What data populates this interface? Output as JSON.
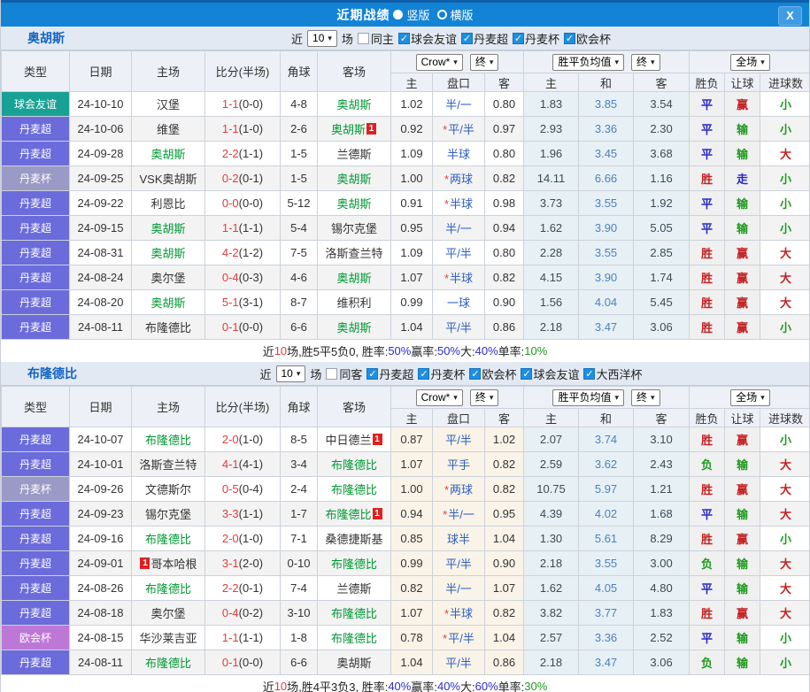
{
  "titlebar": {
    "title": "近期战绩",
    "radios": [
      {
        "label": "竖版",
        "selected": true
      },
      {
        "label": "横版",
        "selected": false
      }
    ],
    "close_label": "X"
  },
  "filter_labels": {
    "near": "近",
    "games": "场"
  },
  "header_labels": {
    "type": "类型",
    "date": "日期",
    "home": "主场",
    "score": "比分(半场)",
    "corner": "角球",
    "away": "客场",
    "bookmaker": "Crow*",
    "final": "终",
    "mean_title": "胜平负均值",
    "fullmatch": "全场",
    "odds_home": "主",
    "odds_handicap": "盘口",
    "odds_away": "客",
    "mean_home": "主",
    "mean_draw": "和",
    "mean_away": "客",
    "result": "胜负",
    "handicap": "让球",
    "goals": "进球数"
  },
  "type_colors": {
    "球会友谊": "#18a295",
    "丹麦超": "#6b6bdb",
    "丹麦杯": "#9a9ac6",
    "欧会杯": "#bd77d6"
  },
  "colors": {
    "titlebar_blue": "#1383d6",
    "checkbox_blue": "#1e8fe0",
    "score_red": "#e43b3b",
    "team_green": "#009933",
    "rank_badge_red": "#e02020"
  },
  "sections": [
    {
      "team": "奥胡斯",
      "filter": {
        "count": "10",
        "same_label": "同主",
        "same_checked": false,
        "leagues": [
          "球会友谊",
          "丹麦超",
          "丹麦杯",
          "欧会杯"
        ]
      },
      "rows": [
        {
          "type": "球会友谊",
          "date": "24-10-10",
          "home": "汉堡",
          "home_green": false,
          "score": "1-1",
          "half": "(0-0)",
          "corners": "4-8",
          "away": "奥胡斯",
          "away_green": true,
          "odds": [
            "1.02",
            "半/一",
            "0.80"
          ],
          "star": false,
          "mean": [
            "1.83",
            "3.85",
            "3.54"
          ],
          "result": "平",
          "handicap_result": "赢",
          "goals": "小"
        },
        {
          "type": "丹麦超",
          "date": "24-10-06",
          "home": "维堡",
          "home_green": false,
          "score": "1-1",
          "half": "(1-0)",
          "corners": "2-6",
          "away": "奥胡斯",
          "away_green": true,
          "away_badge": "1",
          "odds": [
            "0.92",
            "平/半",
            "0.97"
          ],
          "star": true,
          "mean": [
            "2.93",
            "3.36",
            "2.30"
          ],
          "result": "平",
          "handicap_result": "输",
          "goals": "小"
        },
        {
          "type": "丹麦超",
          "date": "24-09-28",
          "home": "奥胡斯",
          "home_green": true,
          "score": "2-2",
          "half": "(1-1)",
          "corners": "1-5",
          "away": "兰德斯",
          "away_green": false,
          "odds": [
            "1.09",
            "半球",
            "0.80"
          ],
          "star": false,
          "mean": [
            "1.96",
            "3.45",
            "3.68"
          ],
          "result": "平",
          "handicap_result": "输",
          "goals": "大"
        },
        {
          "type": "丹麦杯",
          "date": "24-09-25",
          "home": "VSK奥胡斯",
          "home_green": false,
          "score": "0-2",
          "half": "(0-1)",
          "corners": "1-5",
          "away": "奥胡斯",
          "away_green": true,
          "odds": [
            "1.00",
            "两球",
            "0.82"
          ],
          "star": true,
          "mean": [
            "14.11",
            "6.66",
            "1.16"
          ],
          "result": "胜",
          "handicap_result": "走",
          "goals": "小"
        },
        {
          "type": "丹麦超",
          "date": "24-09-22",
          "home": "利恩比",
          "home_green": false,
          "score": "0-0",
          "half": "(0-0)",
          "corners": "5-12",
          "away": "奥胡斯",
          "away_green": true,
          "odds": [
            "0.91",
            "半球",
            "0.98"
          ],
          "star": true,
          "mean": [
            "3.73",
            "3.55",
            "1.92"
          ],
          "result": "平",
          "handicap_result": "输",
          "goals": "小"
        },
        {
          "type": "丹麦超",
          "date": "24-09-15",
          "home": "奥胡斯",
          "home_green": true,
          "score": "1-1",
          "half": "(1-1)",
          "corners": "5-4",
          "away": "锡尔克堡",
          "away_green": false,
          "odds": [
            "0.95",
            "半/一",
            "0.94"
          ],
          "star": false,
          "mean": [
            "1.62",
            "3.90",
            "5.05"
          ],
          "result": "平",
          "handicap_result": "输",
          "goals": "小"
        },
        {
          "type": "丹麦超",
          "date": "24-08-31",
          "home": "奥胡斯",
          "home_green": true,
          "score": "4-2",
          "half": "(1-2)",
          "corners": "7-5",
          "away": "洛斯查兰特",
          "away_green": false,
          "odds": [
            "1.09",
            "平/半",
            "0.80"
          ],
          "star": false,
          "mean": [
            "2.28",
            "3.55",
            "2.85"
          ],
          "result": "胜",
          "handicap_result": "赢",
          "goals": "大"
        },
        {
          "type": "丹麦超",
          "date": "24-08-24",
          "home": "奥尔堡",
          "home_green": false,
          "score": "0-4",
          "half": "(0-3)",
          "corners": "4-6",
          "away": "奥胡斯",
          "away_green": true,
          "odds": [
            "1.07",
            "半球",
            "0.82"
          ],
          "star": true,
          "mean": [
            "4.15",
            "3.90",
            "1.74"
          ],
          "result": "胜",
          "handicap_result": "赢",
          "goals": "大"
        },
        {
          "type": "丹麦超",
          "date": "24-08-20",
          "home": "奥胡斯",
          "home_green": true,
          "score": "5-1",
          "half": "(3-1)",
          "corners": "8-7",
          "away": "维积利",
          "away_green": false,
          "odds": [
            "0.99",
            "一球",
            "0.90"
          ],
          "star": false,
          "mean": [
            "1.56",
            "4.04",
            "5.45"
          ],
          "result": "胜",
          "handicap_result": "赢",
          "goals": "大"
        },
        {
          "type": "丹麦超",
          "date": "24-08-11",
          "home": "布隆德比",
          "home_green": false,
          "score": "0-1",
          "half": "(0-0)",
          "corners": "6-6",
          "away": "奥胡斯",
          "away_green": true,
          "odds": [
            "1.04",
            "平/半",
            "0.86"
          ],
          "star": false,
          "mean": [
            "2.18",
            "3.47",
            "3.06"
          ],
          "result": "胜",
          "handicap_result": "赢",
          "goals": "小"
        }
      ],
      "summary": [
        {
          "t": "近",
          "c": "k"
        },
        {
          "t": "10",
          "c": "r"
        },
        {
          "t": "场,胜5平5负0, 胜率:",
          "c": "k"
        },
        {
          "t": "50%",
          "c": "b"
        },
        {
          "t": " 赢率:",
          "c": "k"
        },
        {
          "t": "50%",
          "c": "b"
        },
        {
          "t": " 大:",
          "c": "k"
        },
        {
          "t": "40%",
          "c": "b"
        },
        {
          "t": " 单率:",
          "c": "k"
        },
        {
          "t": "10%",
          "c": "g"
        }
      ]
    },
    {
      "team": "布隆德比",
      "filter": {
        "count": "10",
        "same_label": "同客",
        "same_checked": false,
        "leagues": [
          "丹麦超",
          "丹麦杯",
          "欧会杯",
          "球会友谊",
          "大西洋杯"
        ]
      },
      "rows": [
        {
          "type": "丹麦超",
          "date": "24-10-07",
          "home": "布隆德比",
          "home_green": true,
          "score": "2-0",
          "half": "(1-0)",
          "corners": "8-5",
          "away": "中日德兰",
          "away_green": false,
          "away_badge": "1",
          "odds": [
            "0.87",
            "平/半",
            "1.02"
          ],
          "star": false,
          "mean": [
            "2.07",
            "3.74",
            "3.10"
          ],
          "result": "胜",
          "handicap_result": "赢",
          "goals": "小"
        },
        {
          "type": "丹麦超",
          "date": "24-10-01",
          "home": "洛斯查兰特",
          "home_green": false,
          "score": "4-1",
          "half": "(4-1)",
          "corners": "3-4",
          "away": "布隆德比",
          "away_green": true,
          "odds": [
            "1.07",
            "平手",
            "0.82"
          ],
          "star": false,
          "mean": [
            "2.59",
            "3.62",
            "2.43"
          ],
          "result": "负",
          "handicap_result": "输",
          "goals": "大"
        },
        {
          "type": "丹麦杯",
          "date": "24-09-26",
          "home": "文德斯尔",
          "home_green": false,
          "score": "0-5",
          "half": "(0-4)",
          "corners": "2-4",
          "away": "布隆德比",
          "away_green": true,
          "odds": [
            "1.00",
            "两球",
            "0.82"
          ],
          "star": true,
          "mean": [
            "10.75",
            "5.97",
            "1.21"
          ],
          "result": "胜",
          "handicap_result": "赢",
          "goals": "大"
        },
        {
          "type": "丹麦超",
          "date": "24-09-23",
          "home": "锡尔克堡",
          "home_green": false,
          "score": "3-3",
          "half": "(1-1)",
          "corners": "1-7",
          "away": "布隆德比",
          "away_green": true,
          "away_badge": "1",
          "odds": [
            "0.94",
            "半/一",
            "0.95"
          ],
          "star": true,
          "mean": [
            "4.39",
            "4.02",
            "1.68"
          ],
          "result": "平",
          "handicap_result": "输",
          "goals": "大"
        },
        {
          "type": "丹麦超",
          "date": "24-09-16",
          "home": "布隆德比",
          "home_green": true,
          "score": "2-0",
          "half": "(1-0)",
          "corners": "7-1",
          "away": "桑德捷斯基",
          "away_green": false,
          "odds": [
            "0.85",
            "球半",
            "1.04"
          ],
          "star": false,
          "mean": [
            "1.30",
            "5.61",
            "8.29"
          ],
          "result": "胜",
          "handicap_result": "赢",
          "goals": "小"
        },
        {
          "type": "丹麦超",
          "date": "24-09-01",
          "home": "哥本哈根",
          "home_green": false,
          "home_badge": "1",
          "home_badge_pos": "before",
          "score": "3-1",
          "half": "(2-0)",
          "corners": "0-10",
          "away": "布隆德比",
          "away_green": true,
          "odds": [
            "0.99",
            "平/半",
            "0.90"
          ],
          "star": false,
          "mean": [
            "2.18",
            "3.55",
            "3.00"
          ],
          "result": "负",
          "handicap_result": "输",
          "goals": "大"
        },
        {
          "type": "丹麦超",
          "date": "24-08-26",
          "home": "布隆德比",
          "home_green": true,
          "score": "2-2",
          "half": "(0-1)",
          "corners": "7-4",
          "away": "兰德斯",
          "away_green": false,
          "odds": [
            "0.82",
            "半/一",
            "1.07"
          ],
          "star": false,
          "mean": [
            "1.62",
            "4.05",
            "4.80"
          ],
          "result": "平",
          "handicap_result": "输",
          "goals": "大"
        },
        {
          "type": "丹麦超",
          "date": "24-08-18",
          "home": "奥尔堡",
          "home_green": false,
          "score": "0-4",
          "half": "(0-2)",
          "corners": "3-10",
          "away": "布隆德比",
          "away_green": true,
          "odds": [
            "1.07",
            "半球",
            "0.82"
          ],
          "star": true,
          "mean": [
            "3.82",
            "3.77",
            "1.83"
          ],
          "result": "胜",
          "handicap_result": "赢",
          "goals": "大"
        },
        {
          "type": "欧会杯",
          "date": "24-08-15",
          "home": "华沙莱吉亚",
          "home_green": false,
          "score": "1-1",
          "half": "(1-1)",
          "corners": "1-8",
          "away": "布隆德比",
          "away_green": true,
          "odds": [
            "0.78",
            "平/半",
            "1.04"
          ],
          "star": true,
          "mean": [
            "2.57",
            "3.36",
            "2.52"
          ],
          "result": "平",
          "handicap_result": "输",
          "goals": "小"
        },
        {
          "type": "丹麦超",
          "date": "24-08-11",
          "home": "布隆德比",
          "home_green": true,
          "score": "0-1",
          "half": "(0-0)",
          "corners": "6-6",
          "away": "奥胡斯",
          "away_green": false,
          "odds": [
            "1.04",
            "平/半",
            "0.86"
          ],
          "star": false,
          "mean": [
            "2.18",
            "3.47",
            "3.06"
          ],
          "result": "负",
          "handicap_result": "输",
          "goals": "小"
        }
      ],
      "summary": [
        {
          "t": "近",
          "c": "k"
        },
        {
          "t": "10",
          "c": "r"
        },
        {
          "t": "场,胜4平3负3, 胜率:",
          "c": "k"
        },
        {
          "t": "40%",
          "c": "b"
        },
        {
          "t": " 赢率:",
          "c": "k"
        },
        {
          "t": "40%",
          "c": "b"
        },
        {
          "t": " 大:",
          "c": "k"
        },
        {
          "t": "60%",
          "c": "b"
        },
        {
          "t": " 单率:",
          "c": "k"
        },
        {
          "t": "30%",
          "c": "g"
        }
      ]
    }
  ]
}
